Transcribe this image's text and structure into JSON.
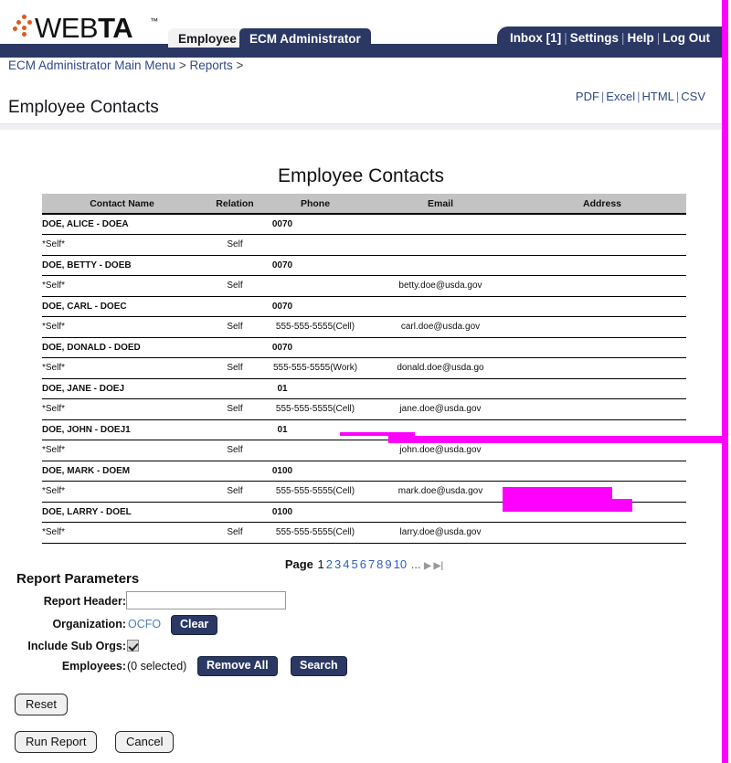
{
  "brand": {
    "logo_text_web": "WEB",
    "logo_text_ta": "TA",
    "logo_tm": "™",
    "accent_color": "#e2571e",
    "navy_color": "#2b3864",
    "annotation_color": "#ff00ff"
  },
  "tabs": [
    {
      "label": "Employee",
      "active": false
    },
    {
      "label": "ECM Administrator",
      "active": true
    }
  ],
  "utility_nav": [
    {
      "label": "Inbox [1]"
    },
    {
      "label": "Settings"
    },
    {
      "label": "Help"
    },
    {
      "label": "Log Out"
    }
  ],
  "nav_separator": "|",
  "breadcrumb": {
    "items": [
      "ECM Administrator Main Menu",
      "Reports"
    ],
    "separator": ">",
    "trailing": ">"
  },
  "exports": {
    "items": [
      "PDF",
      "Excel",
      "HTML",
      "CSV"
    ],
    "separator": "|"
  },
  "page_title": "Employee Contacts",
  "report": {
    "title": "Employee Contacts",
    "columns": [
      "Contact Name",
      "Relation",
      "Phone",
      "Email",
      "Address"
    ],
    "rows": [
      {
        "type": "group",
        "name": "DOE, ALICE - DOEA",
        "code": "0070"
      },
      {
        "type": "detail",
        "name": "*Self*",
        "relation": "Self",
        "phone": "",
        "email": "",
        "address": ""
      },
      {
        "type": "group",
        "name": "DOE, BETTY - DOEB",
        "code": "0070"
      },
      {
        "type": "detail",
        "name": "*Self*",
        "relation": "Self",
        "phone": "",
        "email": "betty.doe@usda.gov",
        "address": ""
      },
      {
        "type": "group",
        "name": "DOE, CARL - DOEC",
        "code": "0070"
      },
      {
        "type": "detail",
        "name": "*Self*",
        "relation": "Self",
        "phone": "555-555-5555(Cell)",
        "email": "carl.doe@usda.gov",
        "address": ""
      },
      {
        "type": "group",
        "name": "DOE, DONALD - DOED",
        "code": "0070"
      },
      {
        "type": "detail",
        "name": "*Self*",
        "relation": "Self",
        "phone": "555-555-5555(Work)",
        "email": "donald.doe@usda.go",
        "address": ""
      },
      {
        "type": "group",
        "name": "DOE, JANE - DOEJ",
        "code": "01"
      },
      {
        "type": "detail",
        "name": "*Self*",
        "relation": "Self",
        "phone": "555-555-5555(Cell)",
        "email": "jane.doe@usda.gov",
        "address": ""
      },
      {
        "type": "group",
        "name": "DOE, JOHN - DOEJ1",
        "code": "01"
      },
      {
        "type": "detail",
        "name": "*Self*",
        "relation": "Self",
        "phone": "",
        "email": "john.doe@usda.gov",
        "address": ""
      },
      {
        "type": "group",
        "name": "DOE, MARK - DOEM",
        "code": "0100"
      },
      {
        "type": "detail",
        "name": "*Self*",
        "relation": "Self",
        "phone": "555-555-5555(Cell)",
        "email": "mark.doe@usda.gov",
        "address": ""
      },
      {
        "type": "group",
        "name": "DOE, LARRY - DOEL",
        "code": "0100"
      },
      {
        "type": "detail",
        "name": "*Self*",
        "relation": "Self",
        "phone": "555-555-5555(Cell)",
        "email": "larry.doe@usda.gov",
        "address": ""
      }
    ]
  },
  "pagination": {
    "label": "Page",
    "pages": [
      "1",
      "2",
      "3",
      "4",
      "5",
      "6",
      "7",
      "8",
      "9",
      "10"
    ],
    "current": "1",
    "ellipsis": "...",
    "next_icon": "▶",
    "last_icon": "▶|"
  },
  "parameters": {
    "heading": "Report Parameters",
    "report_header": {
      "label": "Report Header:",
      "value": "",
      "placeholder": ""
    },
    "organization": {
      "label": "Organization:",
      "value": "OCFO",
      "clear_label": "Clear"
    },
    "include_sub_orgs": {
      "label": "Include Sub Orgs:",
      "checked": true
    },
    "employees": {
      "label": "Employees:",
      "value": "(0 selected)",
      "remove_all_label": "Remove All",
      "search_label": "Search"
    }
  },
  "actions": {
    "reset_label": "Reset",
    "run_report_label": "Run Report",
    "cancel_label": "Cancel"
  }
}
